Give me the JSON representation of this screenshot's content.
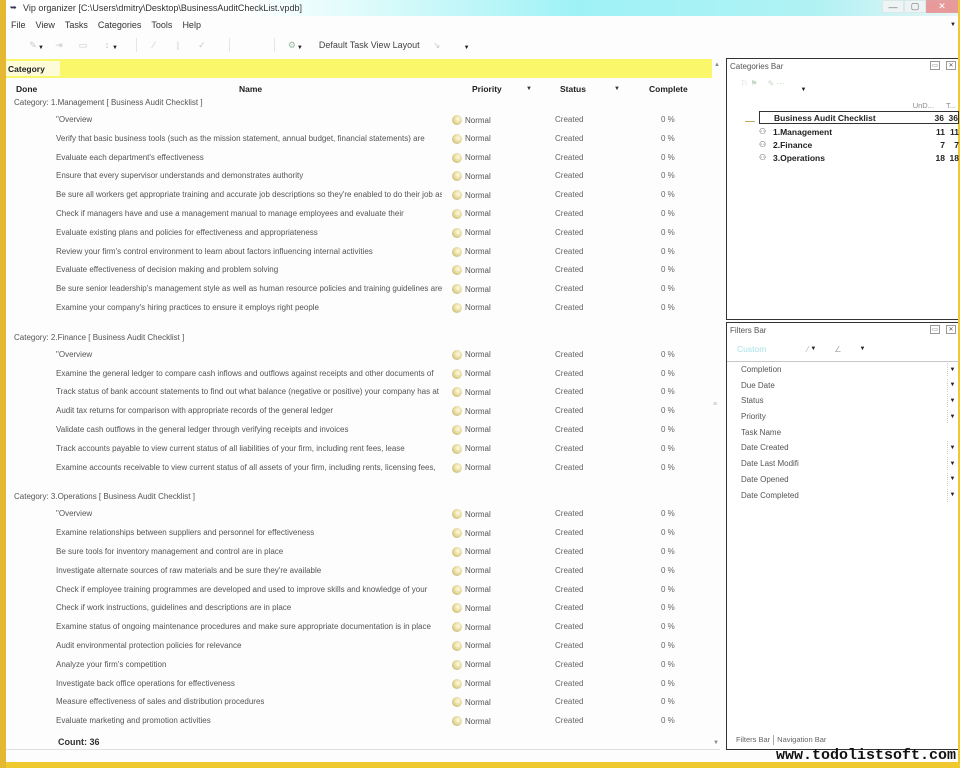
{
  "window": {
    "title": "Vip organizer [C:\\Users\\dmitry\\Desktop\\BusinessAuditCheckList.vpdb]",
    "controls": {
      "minimize": "—",
      "maximize": "▢",
      "close": "✕"
    }
  },
  "menu": [
    "File",
    "View",
    "Tasks",
    "Categories",
    "Tools",
    "Help"
  ],
  "toolbar": {
    "layout_label": "Default Task View Layout"
  },
  "grid": {
    "group_by_chip": "Category",
    "columns": {
      "done": "Done",
      "name": "Name",
      "priority": "Priority",
      "status": "Status",
      "complete": "Complete"
    },
    "groups": [
      {
        "header": "Category: 1.Management    [ Business Audit Checklist ]",
        "tasks": [
          "\"Overview",
          "Verify that basic business tools (such as the mission statement, annual budget, financial statements) are",
          "Evaluate each department's effectiveness",
          "Ensure that every supervisor understands and demonstrates authority",
          "Be sure all workers get appropriate training and accurate job descriptions so they're enabled to do their job as",
          "Check if managers have and use a management manual to manage employees and evaluate their",
          "Evaluate existing plans and policies for effectiveness and appropriateness",
          "Review your firm's control environment to learn about factors influencing internal activities",
          "Evaluate effectiveness of decision making and problem solving",
          "Be sure senior leadership's management style as well as human resource policies and training guidelines are",
          "Examine your company's hiring practices to ensure it employs right people"
        ]
      },
      {
        "header": "Category: 2.Finance    [ Business Audit Checklist ]",
        "tasks": [
          "\"Overview",
          "Examine the general ledger to compare cash inflows and outflows against receipts and other documents of",
          "Track status of bank account statements to find out what balance (negative or positive) your company has at",
          "Audit tax returns for comparison with appropriate records of the general ledger",
          "Validate cash outflows in the general ledger through verifying receipts and invoices",
          "Track accounts payable to view current status of all liabilities of your firm, including rent fees, lease",
          "Examine accounts receivable to view current status of all assets of your firm, including rents, licensing fees,"
        ]
      },
      {
        "header": "Category: 3.Operations    [ Business Audit Checklist ]",
        "tasks": [
          "\"Overview",
          "Examine relationships between suppliers and personnel for effectiveness",
          "Be sure tools for inventory management and control are in place",
          "Investigate alternate sources of raw materials and be sure they're available",
          "Check if employee training programmes are developed and used to improve skills and knowledge of your",
          "Check if work instructions, guidelines and descriptions are in place",
          "Examine status of ongoing maintenance procedures and make sure appropriate documentation is in place",
          "Audit environmental protection policies for relevance",
          "Analyze your firm's competition",
          "Investigate back office operations for effectiveness",
          "Measure effectiveness of sales and distribution procedures",
          "Evaluate marketing and promotion activities"
        ]
      }
    ],
    "default_priority": "Normal",
    "default_status": "Created",
    "default_complete": "0 %",
    "count_label": "Count: 36"
  },
  "categories_bar": {
    "title": "Categories Bar",
    "columns": [
      "UnD...",
      "T..."
    ],
    "root": {
      "name": "Business Audit Checklist",
      "undone": "36",
      "total": "36"
    },
    "items": [
      {
        "name": "1.Management",
        "undone": "11",
        "total": "11"
      },
      {
        "name": "2.Finance",
        "undone": "7",
        "total": "7"
      },
      {
        "name": "3.Operations",
        "undone": "18",
        "total": "18"
      }
    ]
  },
  "filters_bar": {
    "title": "Filters Bar",
    "preset": "Custom",
    "filters": [
      {
        "label": "Completion",
        "dropdown": true
      },
      {
        "label": "Due Date",
        "dropdown": true
      },
      {
        "label": "Status",
        "dropdown": true
      },
      {
        "label": "Priority",
        "dropdown": true
      },
      {
        "label": "Task Name",
        "dropdown": false
      },
      {
        "label": "Date Created",
        "dropdown": true
      },
      {
        "label": "Date Last Modifi",
        "dropdown": true
      },
      {
        "label": "Date Opened",
        "dropdown": true
      },
      {
        "label": "Date Completed",
        "dropdown": true
      }
    ],
    "tabs": [
      "Filters Bar",
      "Navigation Bar"
    ]
  },
  "watermark": "www.todolistsoft.com",
  "colors": {
    "frame": "#f0c830",
    "group_bar": "#fbf76a",
    "title_gradient": "#9ef2f6",
    "close_button": "#e89a9a",
    "custom_preset": "#a8e2e8"
  }
}
